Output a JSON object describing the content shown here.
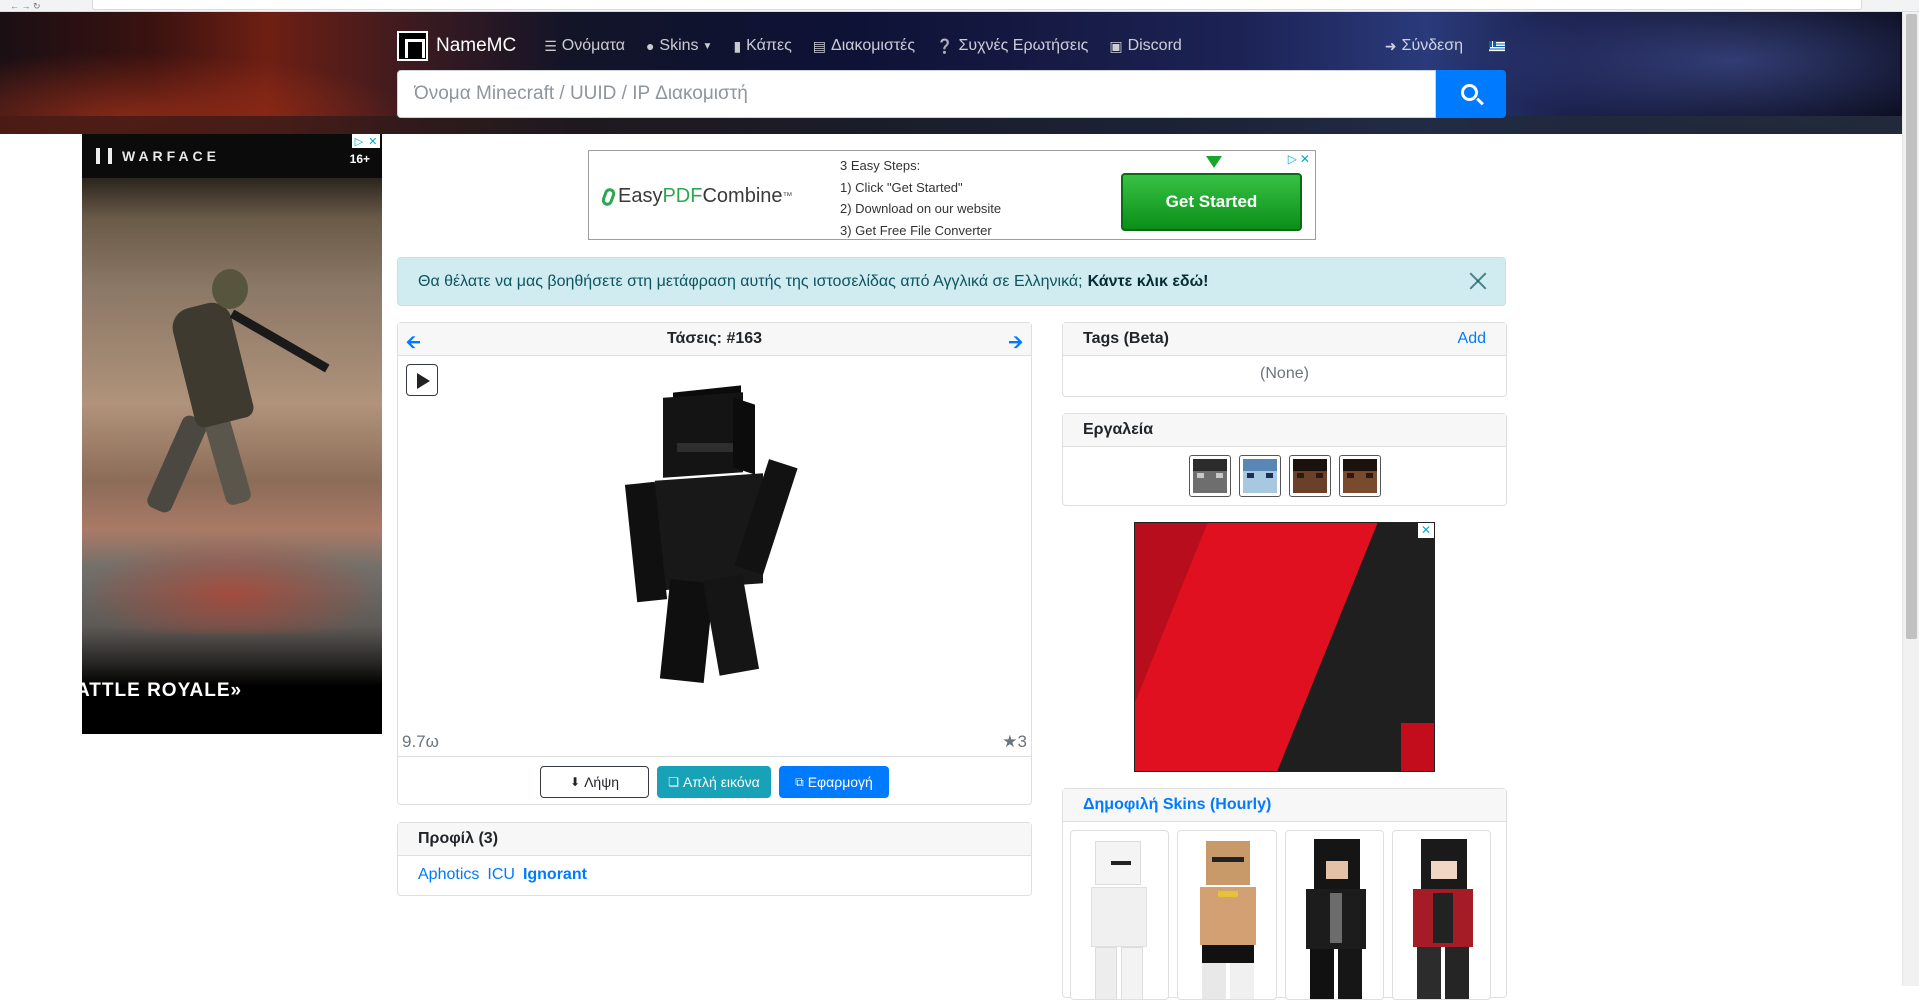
{
  "brand": {
    "name": "NameMC"
  },
  "nav": {
    "items": [
      {
        "label": "Ονόματα",
        "icon": "list-icon"
      },
      {
        "label": "Skins",
        "icon": "user-icon"
      },
      {
        "label": "Κάπες",
        "icon": "bookmark-icon"
      },
      {
        "label": "Διακομιστές",
        "icon": "server-icon"
      },
      {
        "label": "Συχνές Ερωτήσεις",
        "icon": "question-circle-icon"
      },
      {
        "label": "Discord",
        "icon": "discord-icon"
      }
    ],
    "login_label": "Σύνδεση",
    "language_flag": "greek-flag-icon"
  },
  "search": {
    "placeholder": "Όνομα Minecraft / UUID / IP Διακομιστή"
  },
  "ads": {
    "left": {
      "brand": "WARFACE",
      "rating": "16+",
      "tagline": "ATTLE ROYALE»"
    },
    "top": {
      "brand_prefix": "EasyPDF",
      "brand_suffix": "Combine",
      "steps": [
        "3 Easy Steps:",
        "1) Click \"Get Started\"",
        "2) Download on our website",
        "3) Get Free File Converter"
      ],
      "cta": "Get Started"
    }
  },
  "alert": {
    "text": "Θα θέλατε να μας βοηθήσετε στη μετάφραση αυτής της ιστοσελίδας από Αγγλικά σε Ελληνικά;",
    "link": "Κάντε κλικ εδώ!"
  },
  "skin": {
    "title": "Τάσεις: #163",
    "time": "9.7ω",
    "favorites": "★3",
    "buttons": {
      "download": "Λήψη",
      "simple": "Απλή εικόνα",
      "apply": "Εφαρμογή"
    }
  },
  "profiles": {
    "title": "Προφίλ (3)",
    "names": [
      "Aphotics",
      "ICU",
      "Ignorant"
    ]
  },
  "tags": {
    "title": "Tags (Beta)",
    "add": "Add",
    "empty": "(None)"
  },
  "tools": {
    "title": "Εργαλεία",
    "icons": [
      "skin-head-gray-icon",
      "skin-head-blue-icon",
      "skin-head-brown-icon",
      "skin-head-darkbrown-icon"
    ]
  },
  "popular": {
    "title": "Δημοφιλή Skins (Hourly)"
  },
  "colors": {
    "accent": "#007bff",
    "info": "#17a2b8",
    "alert_bg": "#d1ecf1"
  }
}
